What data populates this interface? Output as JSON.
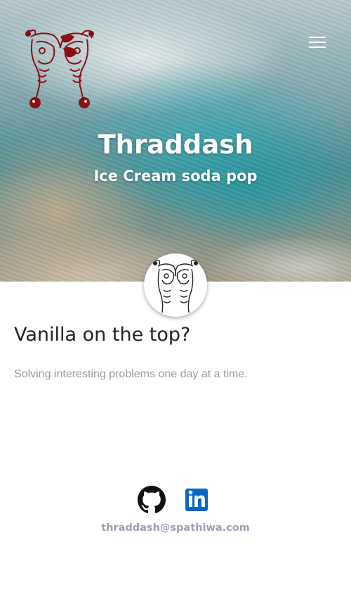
{
  "header": {
    "title": "Thraddash",
    "subtitle": "Ice Cream soda pop",
    "logo_icon": "thraddash-logo-icon",
    "menu_icon": "hamburger-menu-icon"
  },
  "post": {
    "title": "Vanilla on the top?",
    "description": "Solving interesting problems one day at a time."
  },
  "footer": {
    "social": [
      {
        "icon": "github-icon"
      },
      {
        "icon": "linkedin-icon"
      }
    ],
    "email": "thraddash@spathiwa.com"
  },
  "colors": {
    "logo": "#8b0f14",
    "linkedin": "#0a66c2",
    "email": "#9aa0b5"
  }
}
